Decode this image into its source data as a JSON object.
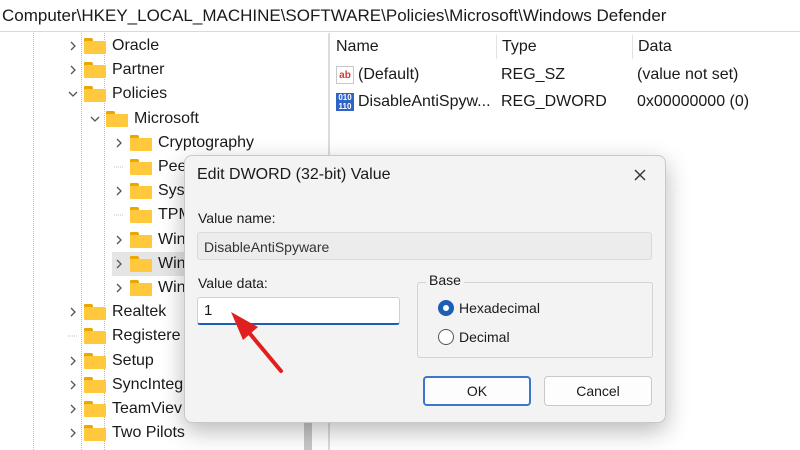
{
  "address_bar": {
    "path": "Computer\\HKEY_LOCAL_MACHINE\\SOFTWARE\\Policies\\Microsoft\\Windows Defender"
  },
  "tree": {
    "items": [
      {
        "label": "Oracle",
        "expander": "collapsed",
        "level": 1
      },
      {
        "label": "Partner",
        "expander": "collapsed",
        "level": 1
      },
      {
        "label": "Policies",
        "expander": "expanded",
        "level": 1
      },
      {
        "label": "Microsoft",
        "expander": "expanded",
        "level": 2
      },
      {
        "label": "Cryptography",
        "expander": "collapsed",
        "level": 3
      },
      {
        "label": "Peer",
        "expander": "none",
        "level": 3
      },
      {
        "label": "Syst",
        "expander": "collapsed",
        "level": 3
      },
      {
        "label": "TPM",
        "expander": "none",
        "level": 3
      },
      {
        "label": "Win",
        "expander": "collapsed",
        "level": 3
      },
      {
        "label": "Win",
        "expander": "collapsed",
        "level": 3,
        "selected": true
      },
      {
        "label": "Win",
        "expander": "collapsed",
        "level": 3
      },
      {
        "label": "Realtek",
        "expander": "collapsed",
        "level": 1
      },
      {
        "label": "Registere",
        "expander": "none",
        "level": 1
      },
      {
        "label": "Setup",
        "expander": "collapsed",
        "level": 1
      },
      {
        "label": "SyncInteg",
        "expander": "collapsed",
        "level": 1
      },
      {
        "label": "TeamViev",
        "expander": "collapsed",
        "level": 1
      },
      {
        "label": "Two Pilots",
        "expander": "collapsed",
        "level": 1
      }
    ]
  },
  "list": {
    "headers": {
      "name": "Name",
      "type": "Type",
      "data": "Data"
    },
    "rows": [
      {
        "icon": "string-value-icon",
        "icon_text": "ab",
        "name": "(Default)",
        "type": "REG_SZ",
        "data": "(value not set)"
      },
      {
        "icon": "dword-value-icon",
        "icon_text": "010 110",
        "name": "DisableAntiSpyw...",
        "type": "REG_DWORD",
        "data": "0x00000000 (0)"
      }
    ]
  },
  "dialog": {
    "title": "Edit DWORD (32-bit) Value",
    "value_name_label": "Value name:",
    "value_name": "DisableAntiSpyware",
    "value_data_label": "Value data:",
    "value_data": "1",
    "base_label": "Base",
    "base_options": [
      {
        "label": "Hexadecimal",
        "selected": true
      },
      {
        "label": "Decimal",
        "selected": false
      }
    ],
    "ok_label": "OK",
    "cancel_label": "Cancel"
  },
  "colors": {
    "accent": "#1a5fb4",
    "annotation_arrow": "#e02020",
    "folder": "#ffc83d"
  }
}
